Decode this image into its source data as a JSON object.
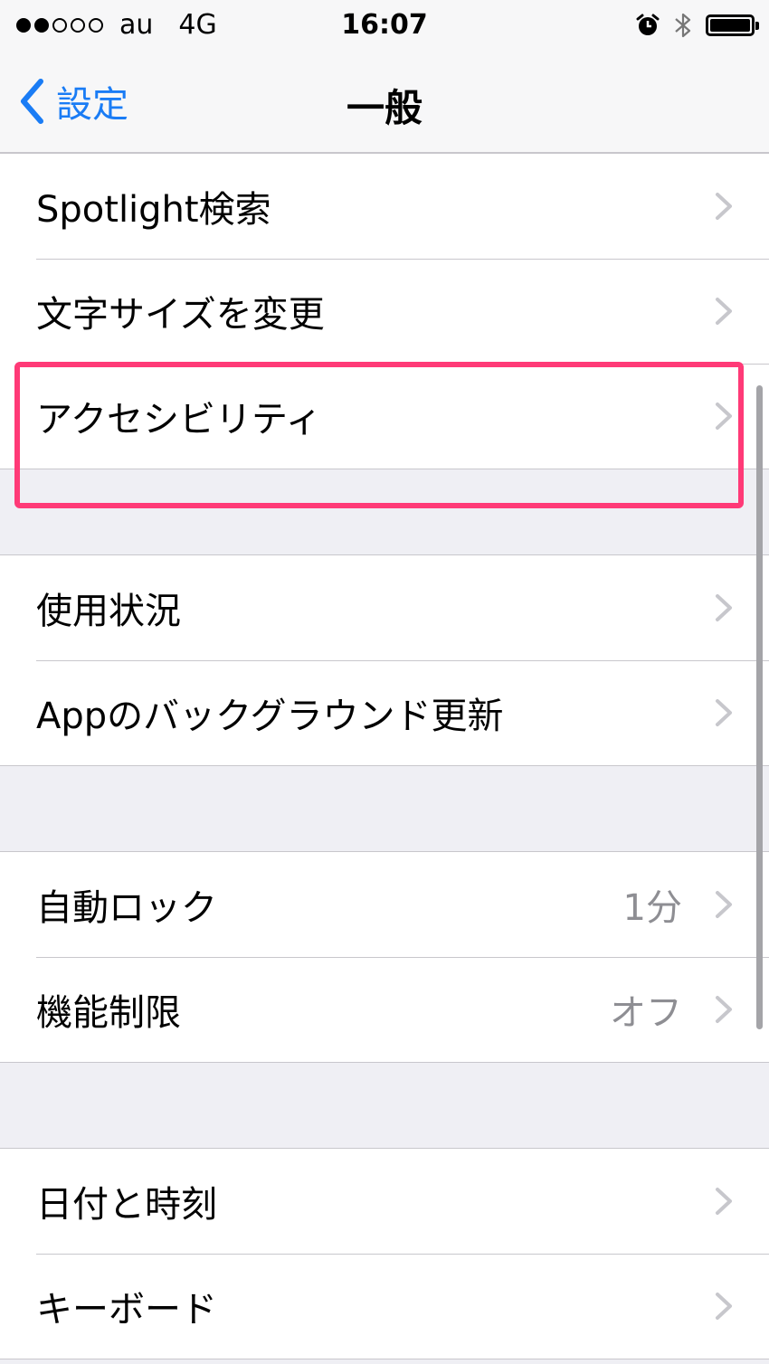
{
  "status_bar": {
    "carrier": "au",
    "network": "4G",
    "time": "16:07",
    "signal_bars_filled": 2,
    "signal_bars_total": 5,
    "icons": [
      "alarm-icon",
      "bluetooth-icon",
      "battery-icon"
    ]
  },
  "nav": {
    "back_label": "設定",
    "title": "一般"
  },
  "groups": [
    {
      "items": [
        {
          "label": "Spotlight検索",
          "value": ""
        },
        {
          "label": "文字サイズを変更",
          "value": ""
        },
        {
          "label": "アクセシビリティ",
          "value": "",
          "highlighted": true
        }
      ]
    },
    {
      "items": [
        {
          "label": "使用状況",
          "value": ""
        },
        {
          "label": "Appのバックグラウンド更新",
          "value": ""
        }
      ]
    },
    {
      "items": [
        {
          "label": "自動ロック",
          "value": "1分"
        },
        {
          "label": "機能制限",
          "value": "オフ"
        }
      ]
    },
    {
      "items": [
        {
          "label": "日付と時刻",
          "value": ""
        },
        {
          "label": "キーボード",
          "value": ""
        }
      ]
    }
  ],
  "colors": {
    "accent": "#1a7cf5",
    "highlight": "#ff3a77",
    "background": "#efeff4",
    "separator": "#c8c7cc",
    "secondary_text": "#8e8e93",
    "chevron": "#c7c7cc"
  }
}
